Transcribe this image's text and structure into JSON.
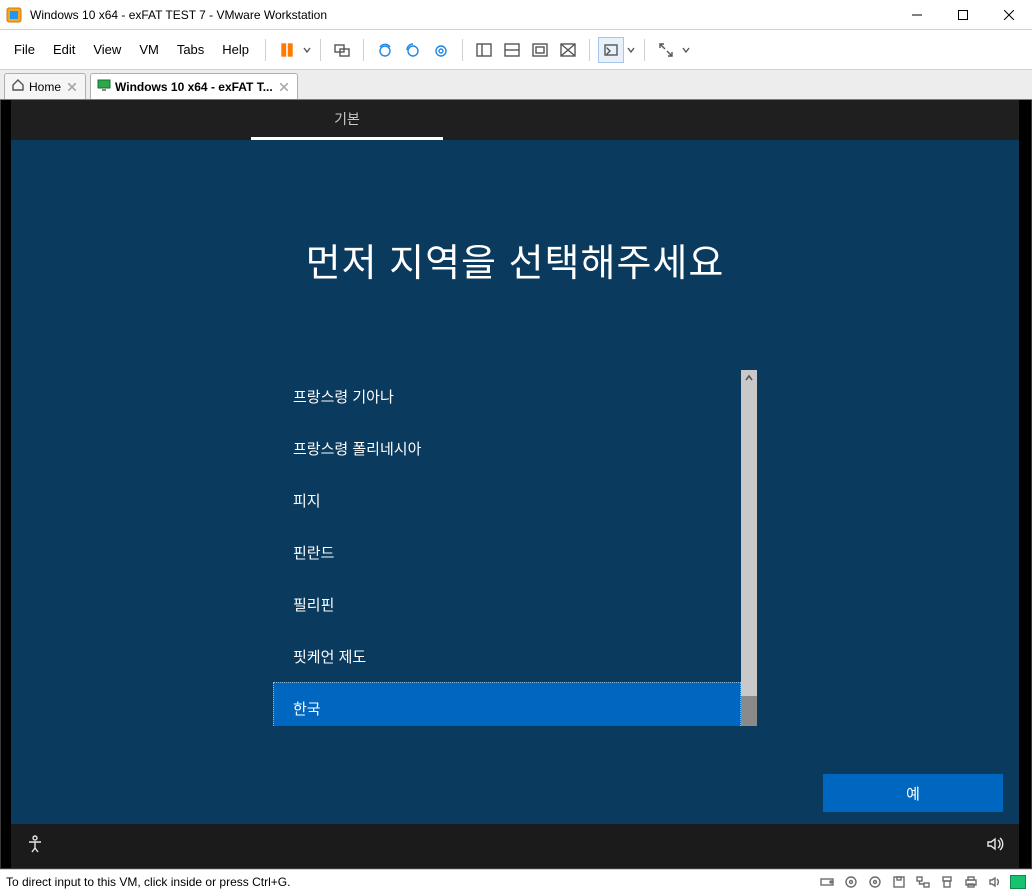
{
  "window": {
    "title": "Windows 10 x64 - exFAT TEST 7 - VMware Workstation"
  },
  "menu": {
    "file": "File",
    "edit": "Edit",
    "view": "View",
    "vm": "VM",
    "tabs": "Tabs",
    "help": "Help"
  },
  "tabs": {
    "home": "Home",
    "vm_label": "Windows 10 x64 - exFAT T..."
  },
  "oobe": {
    "top_tab": "기본",
    "heading": "먼저 지역을 선택해주세요",
    "regions": [
      "프랑스령 기아나",
      "프랑스령 폴리네시아",
      "피지",
      "핀란드",
      "필리핀",
      "핏케언 제도",
      "한국"
    ],
    "selected_index": 6,
    "yes_label": "예"
  },
  "status": {
    "hint": "To direct input to this VM, click inside or press Ctrl+G."
  }
}
